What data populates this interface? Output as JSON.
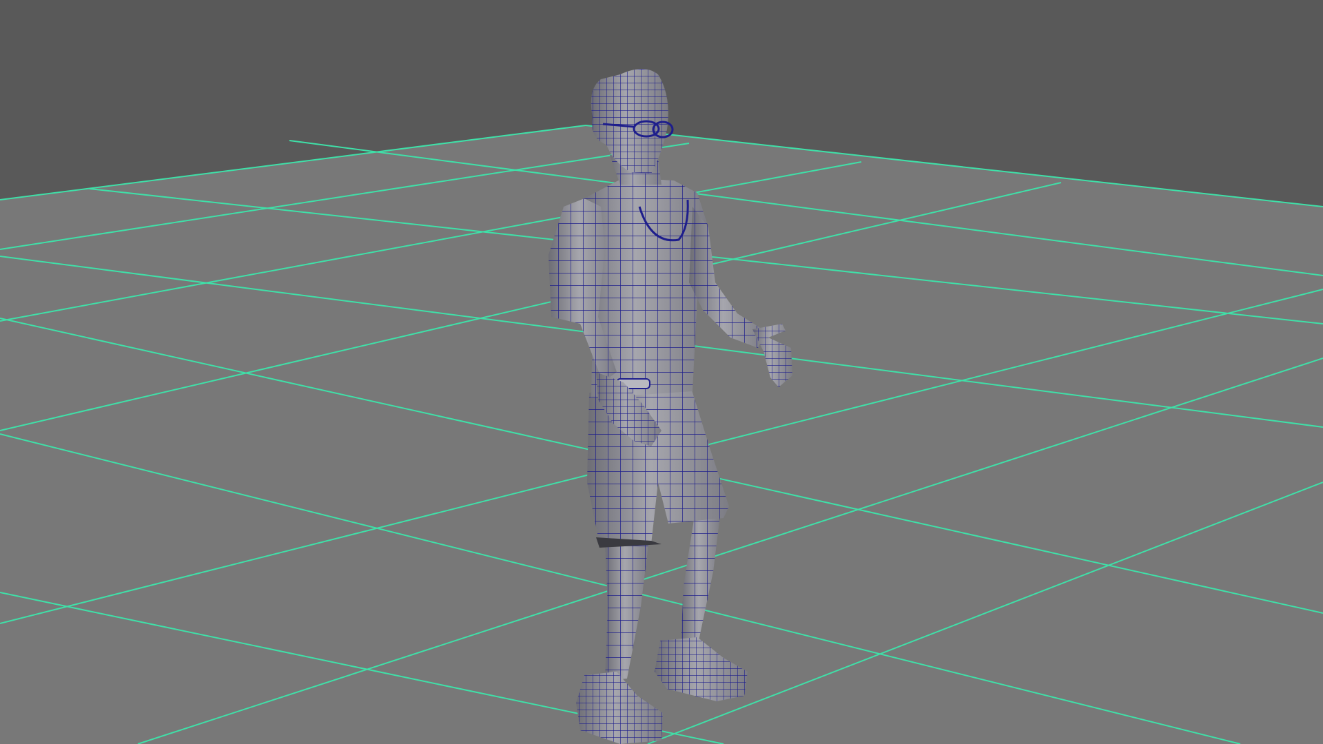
{
  "viewport": {
    "background_color": "#595959",
    "ground_color": "#777777",
    "grid_line_color": "#3fe0a8",
    "wireframe_color": "#1e1e8c",
    "model_fill_color": "#8f8f96",
    "model_shadow_color": "#5e5e66",
    "view": "perspective",
    "grid_visible": true,
    "wireframe_on_shaded": true
  },
  "model": {
    "type": "character-mesh",
    "description_icon": "human-figure-icon"
  }
}
